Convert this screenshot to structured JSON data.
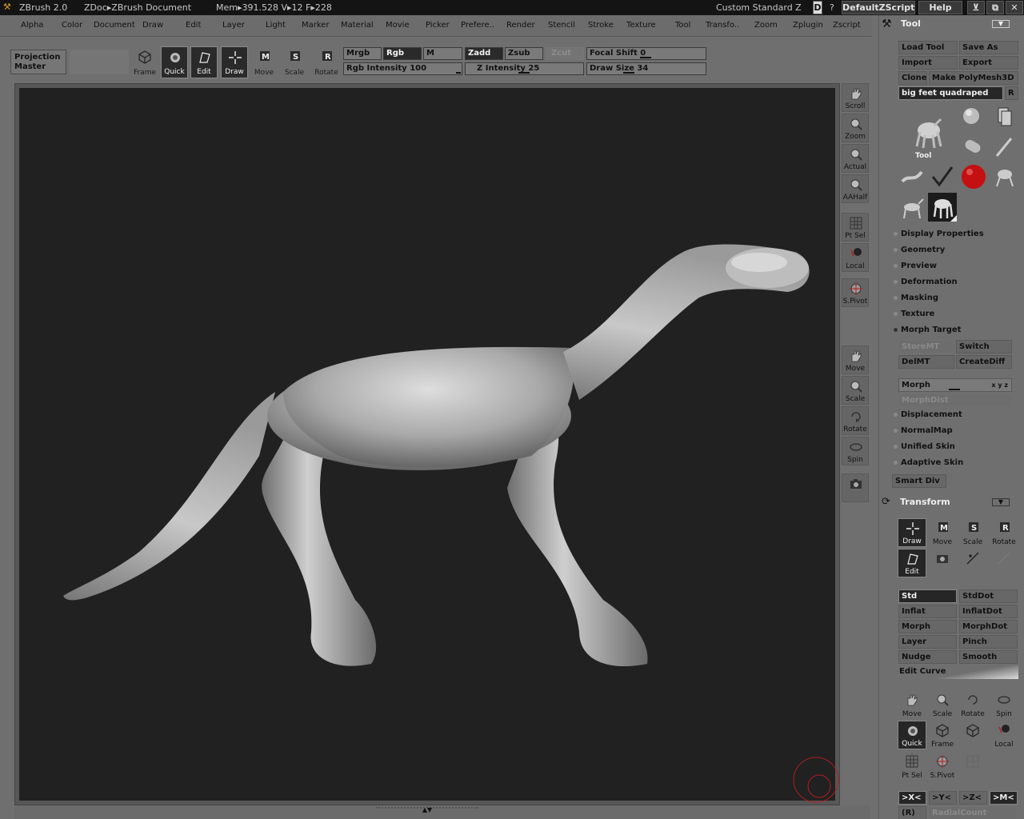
{
  "titlebar": {
    "app": "ZBrush 2.0",
    "doc": "ZDoc▸ZBrush Document",
    "mem": "Mem▸391.528  V▸12  F▸228",
    "layout": "Custom  Standard  Z",
    "d_button": "D",
    "question": "?",
    "script": "DefaultZScript",
    "help": "Help"
  },
  "menu": [
    "Alpha",
    "Color",
    "Document",
    "Draw",
    "Edit",
    "Layer",
    "Light",
    "Marker",
    "Material",
    "Movie",
    "Picker",
    "Prefere..",
    "Render",
    "Stencil",
    "Stroke",
    "Texture",
    "Tool",
    "Transfo..",
    "Zoom",
    "Zplugin",
    "Zscript"
  ],
  "toolbar": {
    "projection_master": "Projection Master",
    "frame": "Frame",
    "quick": "Quick",
    "edit": "Edit",
    "draw": "Draw",
    "move": "Move",
    "scale": "Scale",
    "rotate": "Rotate",
    "mrgb": "Mrgb",
    "rgb": "Rgb",
    "m": "M",
    "zadd": "Zadd",
    "zsub": "Zsub",
    "zcut": "Zcut",
    "rgb_intensity": {
      "label": "Rgb  Intensity",
      "value": "100"
    },
    "z_intensity": {
      "label": "Z  Intensity",
      "value": "25"
    },
    "focal_shift": {
      "label": "Focal  Shift",
      "value": "0"
    },
    "draw_size": {
      "label": "Draw  Size",
      "value": "34"
    }
  },
  "side_tools": [
    "Scroll",
    "Zoom",
    "Actual",
    "AAHalf",
    "Pt Sel",
    "Local",
    "S.Pivot",
    "Move",
    "Scale",
    "Rotate",
    "Spin"
  ],
  "panel": {
    "title": "Tool",
    "load_tool": "Load  Tool",
    "save_as": "Save  As",
    "import": "Import",
    "export": "Export",
    "clone": "Clone",
    "make_polymesh": "Make  PolyMesh3D",
    "tool_name": "big  feet  quadraped",
    "r": "R",
    "tool_label": "Tool",
    "sections": [
      "Display Properties",
      "Geometry",
      "Preview",
      "Deformation",
      "Masking",
      "Texture",
      "Morph Target"
    ],
    "storemt": "StoreMT",
    "switch": "Switch",
    "delmt": "DelMT",
    "creatediff": "CreateDiff",
    "morph": "Morph",
    "morph_dist": "MorphDist",
    "sections2": [
      "Displacement",
      "NormalMap",
      "Unified Skin",
      "Adaptive Skin"
    ],
    "smart_div": "Smart  Div",
    "transform": "Transform",
    "t_draw": "Draw",
    "t_move": "Move",
    "t_scale": "Scale",
    "t_rotate": "Rotate",
    "t_edit": "Edit",
    "brushes": [
      [
        "Std",
        "StdDot"
      ],
      [
        "Inflat",
        "InflatDot"
      ],
      [
        "Morph",
        "MorphDot"
      ],
      [
        "Layer",
        "Pinch"
      ],
      [
        "Nudge",
        "Smooth"
      ]
    ],
    "edit_curve": "Edit  Curve",
    "b_move": "Move",
    "b_scale": "Scale",
    "b_rotate": "Rotate",
    "b_spin": "Spin",
    "b_quick": "Quick",
    "b_frame": "Frame",
    "b_local": "Local",
    "b_ptsel": "Pt Sel",
    "b_spivot": "S.Pivot",
    "axes": [
      ">X<",
      ">Y<",
      ">Z<",
      ">M<"
    ],
    "r_sym": "(R)",
    "radialcount": "RadialCount"
  },
  "colors": {
    "canvas": "#212121",
    "material": "#d0d0d0",
    "swatch": "#c41010",
    "titlebar": "#141414"
  }
}
